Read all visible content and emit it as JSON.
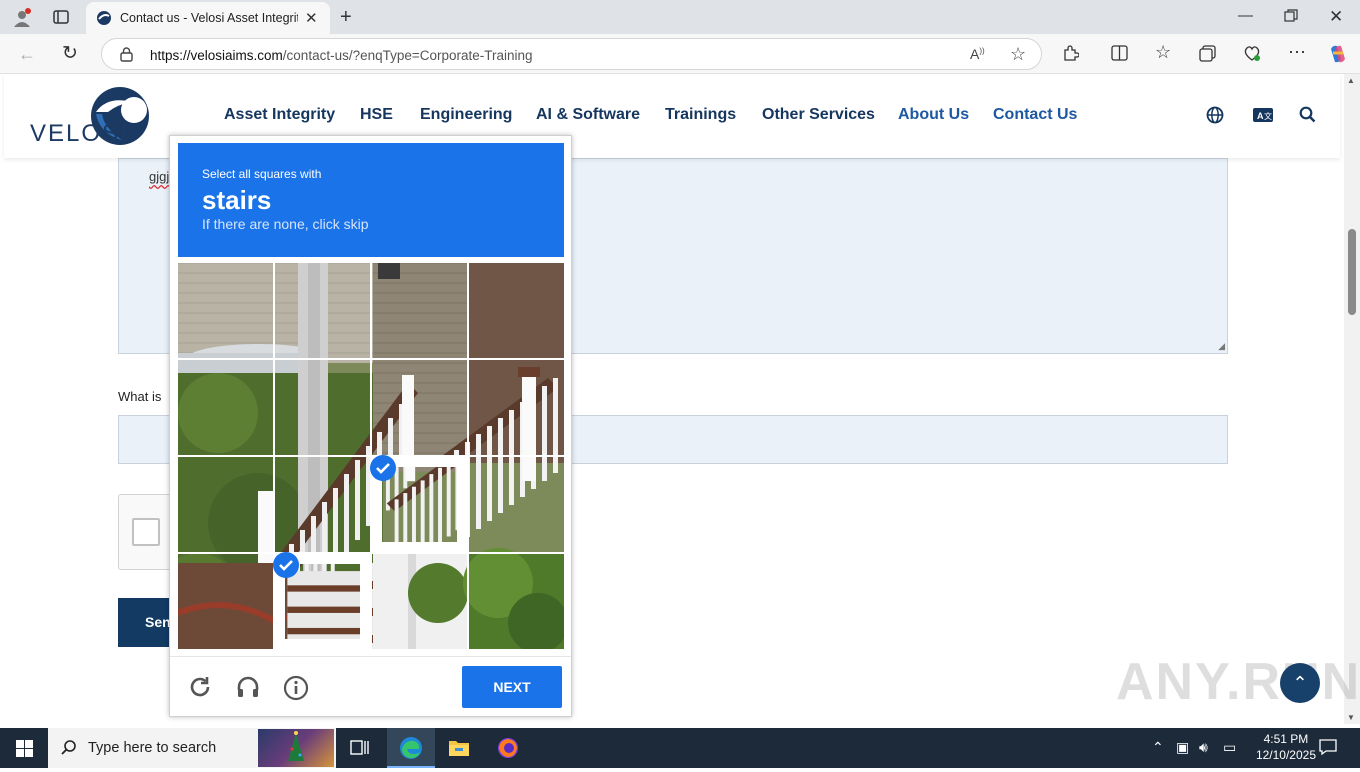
{
  "browser": {
    "tab_title": "Contact us - Velosi Asset Integrity",
    "url_domain": "https://velosiaims.com",
    "url_path": "/contact-us/?enqType=Corporate-Training"
  },
  "site": {
    "logo": "VELOSI",
    "nav": [
      "Asset Integrity",
      "HSE",
      "Engineering",
      "AI & Software",
      "Trainings",
      "Other Services",
      "About Us",
      "Contact Us"
    ]
  },
  "form": {
    "textarea_value": "gjgj",
    "question_label": "What is",
    "send_label": "Sen"
  },
  "captcha": {
    "line1": "Select all squares with",
    "line2": "stairs",
    "line3": "If there are none, click skip",
    "next_label": "NEXT",
    "selected_tiles": [
      10,
      13
    ]
  },
  "taskbar": {
    "search_placeholder": "Type here to search",
    "time": "4:51 PM",
    "date": "12/10/2025"
  },
  "watermark": "ANY.RUN"
}
